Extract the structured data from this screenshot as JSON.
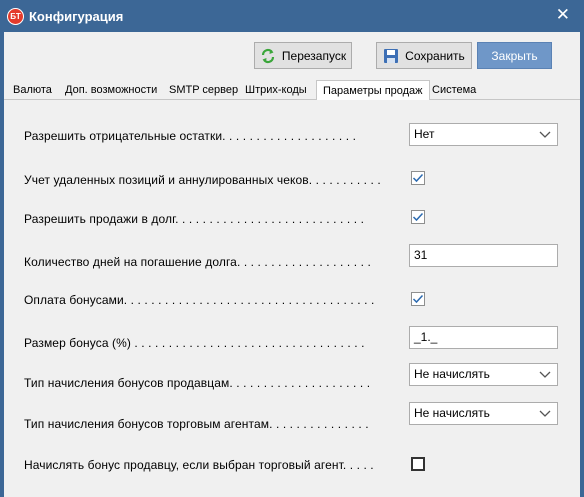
{
  "window": {
    "title": "Конфигурация",
    "icon_text": "БТ"
  },
  "toolbar": {
    "restart_label": "Перезапуск",
    "save_label": "Сохранить",
    "close_label": "Закрыть"
  },
  "tabs": [
    {
      "label": "Валюта"
    },
    {
      "label": "Доп. возможности"
    },
    {
      "label": "SMTP сервер"
    },
    {
      "label": "Штрих-коды"
    },
    {
      "label": "Параметры продаж",
      "active": true
    },
    {
      "label": "Система"
    }
  ],
  "settings": {
    "negative_stock": {
      "label": "Разрешить отрицательные остатки. . . . . . . . . . . . . . . . . . . .",
      "value": "Нет"
    },
    "deleted_positions": {
      "label": "Учет удаленных позиций и аннулированных чеков. . . . . . . . . . .",
      "checked": true
    },
    "sales_on_credit": {
      "label": "Разрешить продажи в долг. . . . . . . . . . . . . . . . . . . . . . . . . . . .",
      "checked": true
    },
    "debt_days": {
      "label": "Количество дней на погашение долга. . . . . . . . . . . . . . . . . . . .",
      "value": "31"
    },
    "bonus_payment": {
      "label": "Оплата бонусами. . . . . . . . . . . . . . . . . . . . . . . . . . . . . . . . . . . . .",
      "checked": true
    },
    "bonus_size": {
      "label": "Размер бонуса (%) . . . . . . . . . . . . . . . . . . . . . . . . . . . . . . . . . .",
      "value": "_1._"
    },
    "seller_bonus_type": {
      "label": "Тип начисления бонусов продавцам. . . . . . . . . . . . . . . . . . . . .",
      "value": "Не начислять"
    },
    "agent_bonus_type": {
      "label": "Тип начисления бонусов торговым агентам. . . . . . . . . . . . . . .",
      "value": "Не начислять"
    },
    "seller_bonus_with_agent": {
      "label": "Начислять бонус продавцу, если выбран торговый агент. . . . .",
      "checked": false
    }
  },
  "colors": {
    "titlebar": "#3c6796",
    "close_button": "#6f97c8",
    "check_mark": "#2c6ab0"
  }
}
